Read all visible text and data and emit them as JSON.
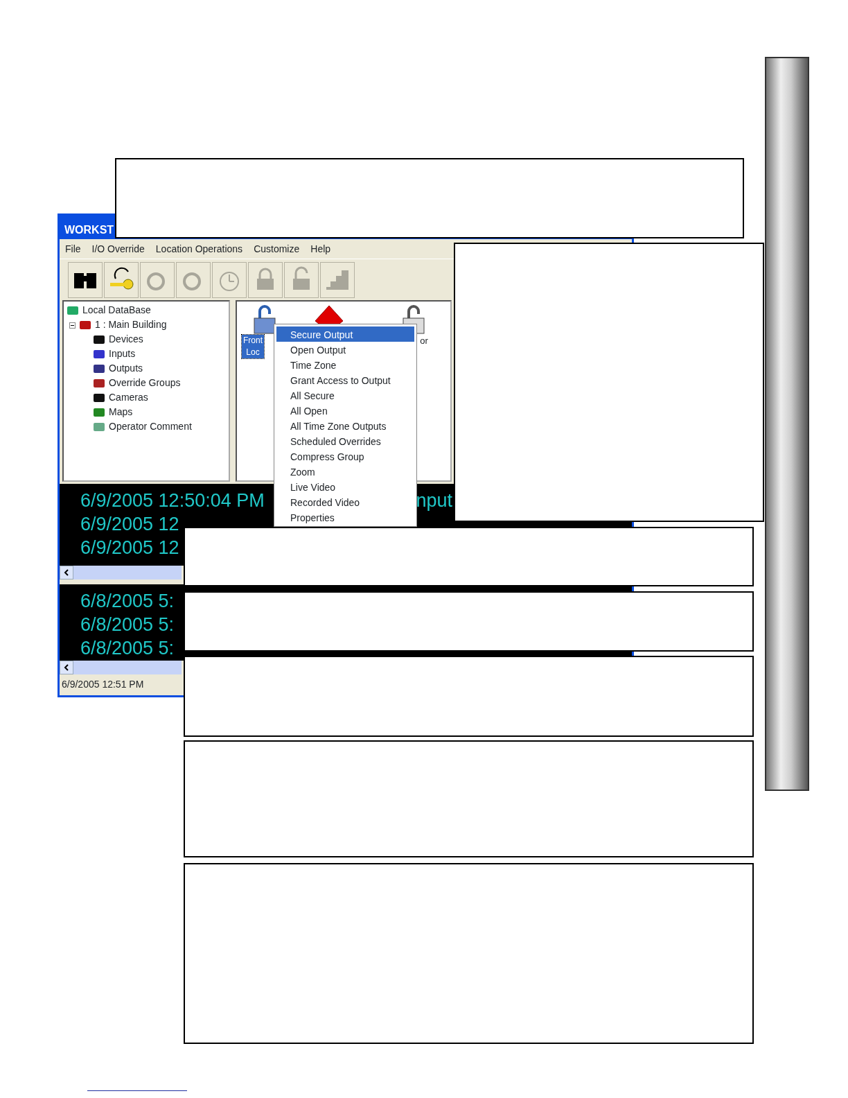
{
  "window": {
    "title": "WORKST"
  },
  "menu_bar": [
    "File",
    "I/O Override",
    "Location Operations",
    "Customize",
    "Help"
  ],
  "toolbar": [
    {
      "disabled": false
    },
    {
      "disabled": false
    },
    {
      "disabled": true
    },
    {
      "disabled": true
    },
    {
      "disabled": true
    },
    {
      "disabled": true
    },
    {
      "disabled": true
    },
    {
      "disabled": true
    }
  ],
  "tree": [
    {
      "label": "Local DataBase",
      "children": [
        {
          "label": "1 : Main Building",
          "expanded": true,
          "children": [
            {
              "label": "Devices"
            },
            {
              "label": "Inputs"
            },
            {
              "label": "Outputs"
            },
            {
              "label": "Override Groups"
            },
            {
              "label": "Cameras"
            },
            {
              "label": "Maps"
            },
            {
              "label": "Operator Comment"
            }
          ]
        }
      ]
    }
  ],
  "outputs": [
    {
      "kind": "lock",
      "lines": [
        "Front",
        "Loc"
      ],
      "selected": true
    },
    {
      "kind": "alarm",
      "selected": false
    },
    {
      "kind": "lock",
      "lines": [
        "or"
      ],
      "selected": false
    }
  ],
  "context_menu": [
    {
      "label": "Secure Output",
      "selected": true
    },
    {
      "label": "Open Output",
      "selected": false
    },
    {
      "label": "Time Zone",
      "selected": false
    },
    {
      "label": "Grant Access to Output",
      "selected": false
    },
    {
      "label": "All Secure",
      "selected": false
    },
    {
      "label": "All Open",
      "selected": false
    },
    {
      "label": "All Time Zone Outputs",
      "selected": false
    },
    {
      "label": "Scheduled Overrides",
      "selected": false
    },
    {
      "label": "Compress Group",
      "selected": false
    },
    {
      "label": "Zoom",
      "selected": false
    },
    {
      "label": "Live Video",
      "selected": false
    },
    {
      "label": "Recorded Video",
      "selected": false
    },
    {
      "label": "Properties",
      "selected": false
    }
  ],
  "event_log": [
    {
      "time": "6/9/2005 12:50:04 PM",
      "column_2": "nput"
    },
    {
      "time": "6/9/2005 12"
    },
    {
      "time": "6/9/2005 12"
    }
  ],
  "alarm_log": [
    {
      "time": "6/8/2005 5:"
    },
    {
      "time": "6/8/2005 5:"
    },
    {
      "time": "6/8/2005 5:"
    }
  ],
  "status_bar": "6/9/2005 12:51 PM"
}
